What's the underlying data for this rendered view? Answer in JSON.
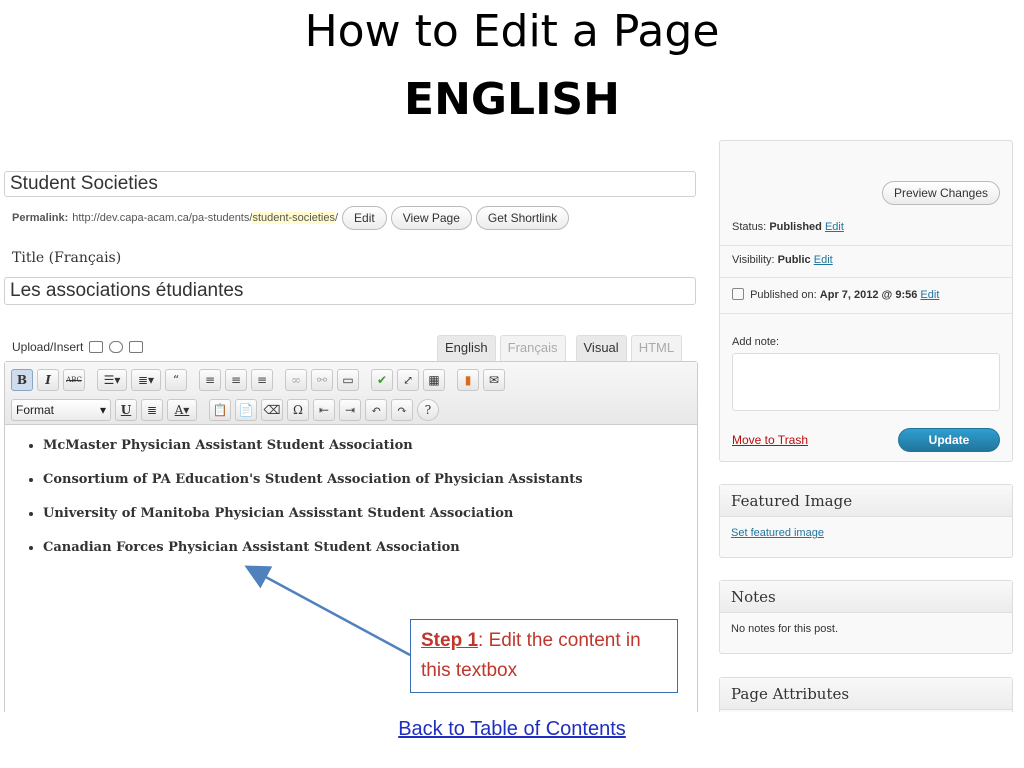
{
  "slide": {
    "title": "How to Edit a Page",
    "subtitle": "ENGLISH",
    "back_link": "Back to Table of Contents"
  },
  "editor": {
    "title_value": "Student Societies",
    "permalink_label": "Permalink:",
    "permalink_base": "http://dev.capa-acam.ca/pa-students/",
    "permalink_slug": "student-societies",
    "permalink_tail": "/",
    "edit_btn": "Edit",
    "view_page_btn": "View Page",
    "shortlink_btn": "Get Shortlink",
    "title_fr_label": "Title (Français)",
    "title_fr_value": "Les associations étudiantes",
    "upload_label": "Upload/Insert",
    "tabs": {
      "english": "English",
      "francais": "Français",
      "visual": "Visual",
      "html": "HTML"
    },
    "format_label": "Format",
    "content_items": [
      "McMaster Physician Assistant Student Association",
      "Consortium of PA Education's Student Association of Physician Assistants",
      "University of Manitoba Physician Assisstant Student Association",
      "Canadian Forces Physician Assistant Student Association"
    ]
  },
  "publish": {
    "preview_btn": "Preview Changes",
    "status_label": "Status:",
    "status_value": "Published",
    "visibility_label": "Visibility:",
    "visibility_value": "Public",
    "published_label": "Published on:",
    "published_value": "Apr 7, 2012 @ 9:56",
    "edit_link": "Edit",
    "add_note_label": "Add note:",
    "trash_link": "Move to Trash",
    "update_btn": "Update"
  },
  "featured_image": {
    "title": "Featured Image",
    "link": "Set featured image"
  },
  "notes_box": {
    "title": "Notes",
    "text": "No notes for this post."
  },
  "page_attributes": {
    "title": "Page Attributes"
  },
  "callout": {
    "step": "Step 1",
    "text": ": Edit the content in this textbox"
  },
  "colors": {
    "link_blue": "#21759b",
    "update_blue": "#21759b",
    "trash_red": "#bc0b0b",
    "callout_red": "#c0362c",
    "callout_border": "#3a6fb5",
    "slug_highlight": "#fffbcc"
  }
}
